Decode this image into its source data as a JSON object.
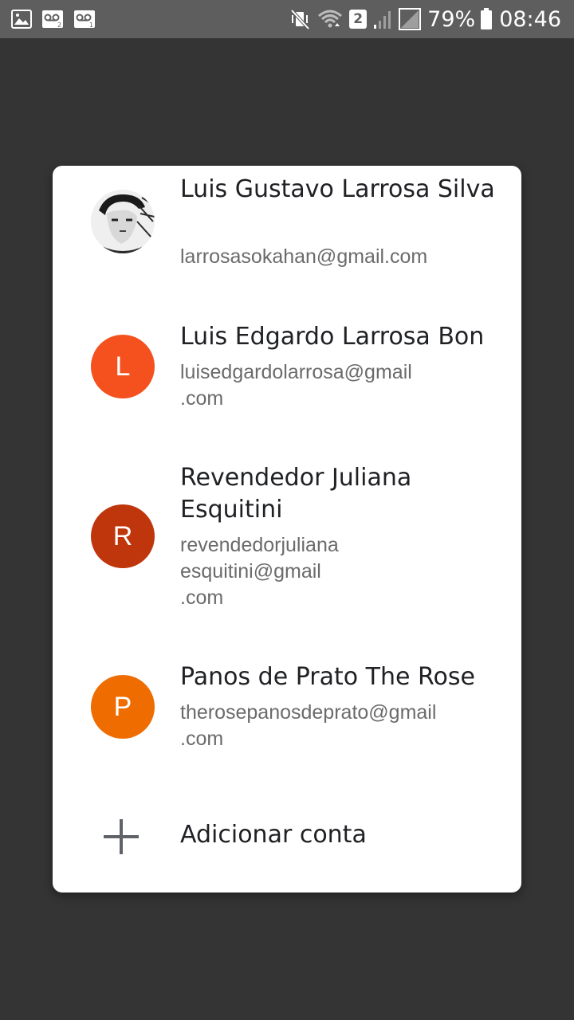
{
  "status_bar": {
    "battery_percent": "79%",
    "time": "08:46",
    "sim_label": "2"
  },
  "accounts": [
    {
      "name": "Luis Gustavo Larrosa Silva",
      "email": "larrosasokahan@gmail.com",
      "avatar": "photo"
    },
    {
      "name": "Luis Edgardo Larrosa Bon",
      "email": "luisedgardolarrosa@gmail\n.com",
      "initial": "L",
      "color": "#F4511E"
    },
    {
      "name": "Revendedor Juliana Esquitini",
      "email": "revendedorjuliana\nesquitini@gmail\n.com",
      "initial": "R",
      "color": "#BF360C"
    },
    {
      "name": "Panos de Prato The Rose",
      "email": "therosepanosdeprato@gmail\n.com",
      "initial": "P",
      "color": "#EF6C00"
    }
  ],
  "add_account": {
    "label": "Adicionar conta",
    "icon": "plus-icon"
  }
}
